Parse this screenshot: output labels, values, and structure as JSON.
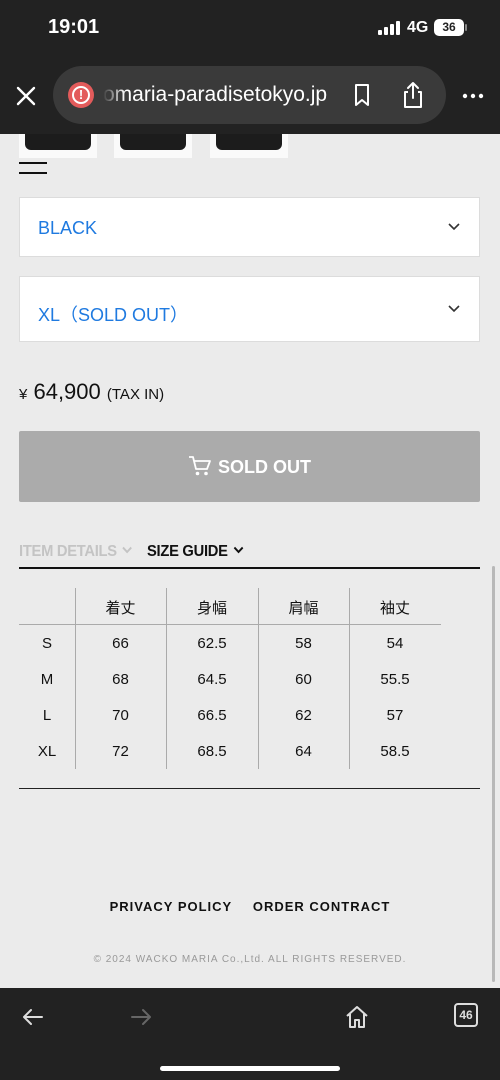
{
  "status_bar": {
    "time": "19:01",
    "network": "4G",
    "battery": "36"
  },
  "browser": {
    "url": "waco maria-paradisetokyo.jp",
    "url_visible": "omaria-paradisetokyo.jp",
    "tab_count": "46"
  },
  "product": {
    "color_select": {
      "value": "BLACK"
    },
    "size_select": {
      "value": "XL（SOLD OUT）"
    },
    "price": {
      "currency": "¥",
      "amount": "64,900",
      "tax_note": "(TAX IN)"
    },
    "soldout_button": {
      "label": "SOLD OUT"
    }
  },
  "tabs": [
    {
      "label": "ITEM DETAILS",
      "active": false
    },
    {
      "label": "SIZE GUIDE",
      "active": true
    }
  ],
  "size_table": {
    "headers": [
      "",
      "着丈",
      "身幅",
      "肩幅",
      "袖丈"
    ],
    "rows": [
      [
        "S",
        "66",
        "62.5",
        "58",
        "54"
      ],
      [
        "M",
        "68",
        "64.5",
        "60",
        "55.5"
      ],
      [
        "L",
        "70",
        "66.5",
        "62",
        "57"
      ],
      [
        "XL",
        "72",
        "68.5",
        "64",
        "58.5"
      ]
    ]
  },
  "footer": {
    "links": [
      "PRIVACY POLICY",
      "ORDER CONTRACT"
    ],
    "copyright": "© 2024 WACKO MARIA Co.,Ltd. ALL RIGHTS RESERVED."
  },
  "colors": {
    "accent_link": "#1f7ae0",
    "soldout_gray": "#ababab",
    "chrome_dark": "#222222",
    "warning_red": "#e35b5b"
  },
  "icons": [
    "close-icon",
    "warning-icon",
    "bookmark-icon",
    "share-icon",
    "more-icon",
    "menu-icon",
    "chevron-down-icon",
    "cart-icon",
    "back-icon",
    "forward-icon",
    "home-icon",
    "tabs-icon"
  ]
}
